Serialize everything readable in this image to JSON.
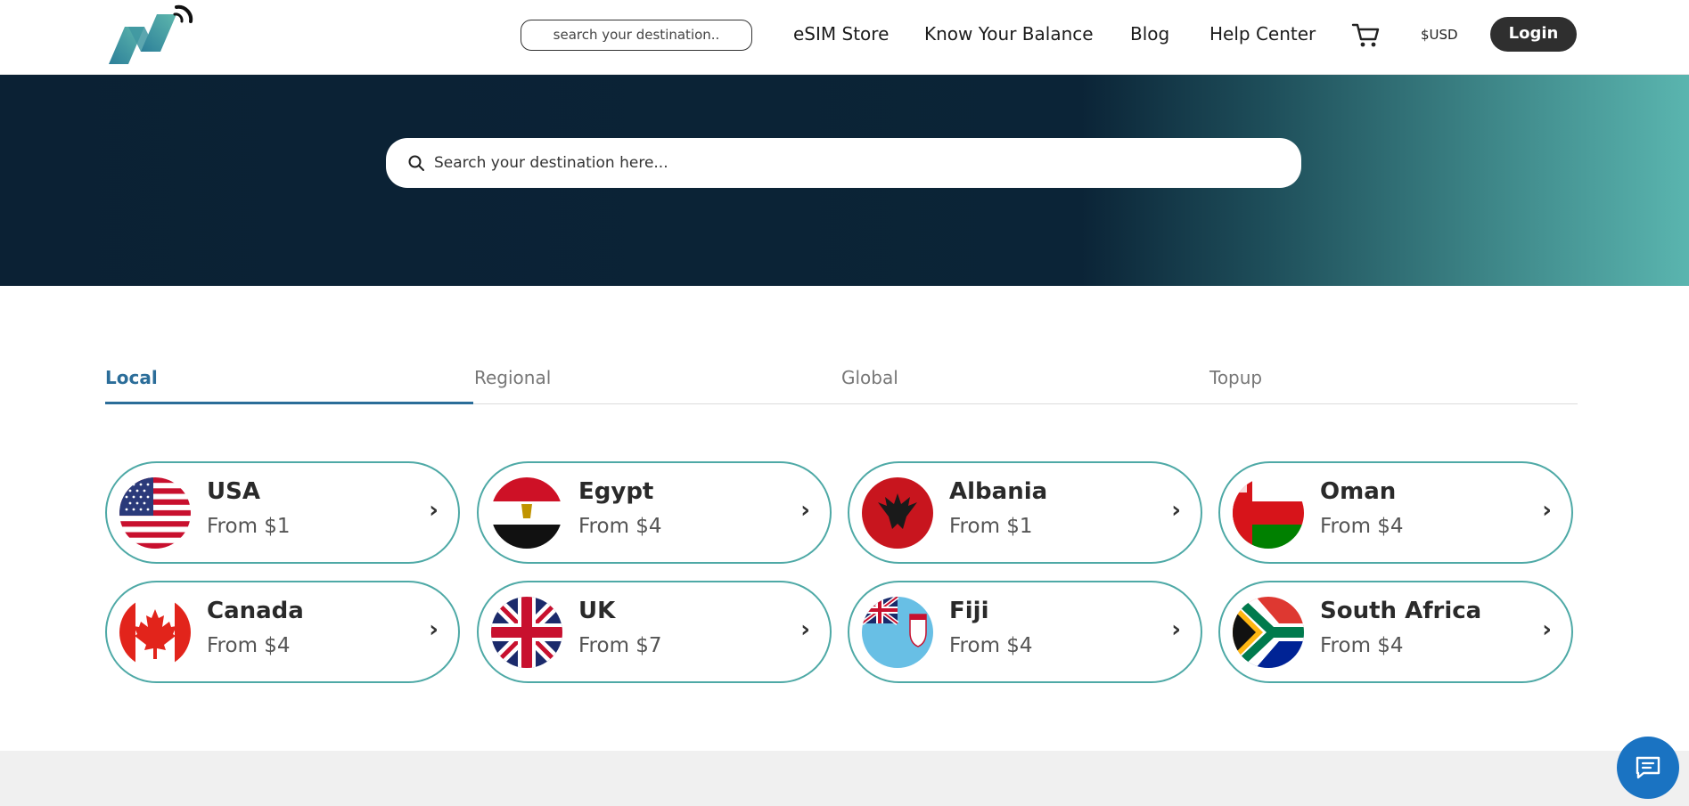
{
  "header": {
    "search_placeholder": "search your destination..",
    "nav": [
      {
        "label": "eSIM Store"
      },
      {
        "label": "Know Your Balance"
      },
      {
        "label": "Blog"
      },
      {
        "label": "Help Center"
      }
    ],
    "cart_icon": "cart-icon",
    "currency": "$USD",
    "login_label": "Login"
  },
  "hero": {
    "search_placeholder": "Search your destination here..."
  },
  "tabs": [
    {
      "label": "Local",
      "active": true
    },
    {
      "label": "Regional",
      "active": false
    },
    {
      "label": "Global",
      "active": false
    },
    {
      "label": "Topup",
      "active": false
    }
  ],
  "destinations": [
    {
      "country": "USA",
      "price": "From $1",
      "flag": "usa-flag-icon"
    },
    {
      "country": "Egypt",
      "price": "From $4",
      "flag": "egypt-flag-icon"
    },
    {
      "country": "Albania",
      "price": "From $1",
      "flag": "albania-flag-icon"
    },
    {
      "country": "Oman",
      "price": "From $4",
      "flag": "oman-flag-icon"
    },
    {
      "country": "Canada",
      "price": "From $4",
      "flag": "canada-flag-icon"
    },
    {
      "country": "UK",
      "price": "From $7",
      "flag": "uk-flag-icon"
    },
    {
      "country": "Fiji",
      "price": "From $4",
      "flag": "fiji-flag-icon"
    },
    {
      "country": "South Africa",
      "price": "From $4",
      "flag": "south-africa-flag-icon"
    }
  ],
  "chevron": "›",
  "colors": {
    "brand_teal": "#4ea9a6",
    "hero_dark": "#0b2437",
    "tab_active": "#2b6d99",
    "login_bg": "#2f2f2f",
    "chat_button": "#1a73c2"
  }
}
